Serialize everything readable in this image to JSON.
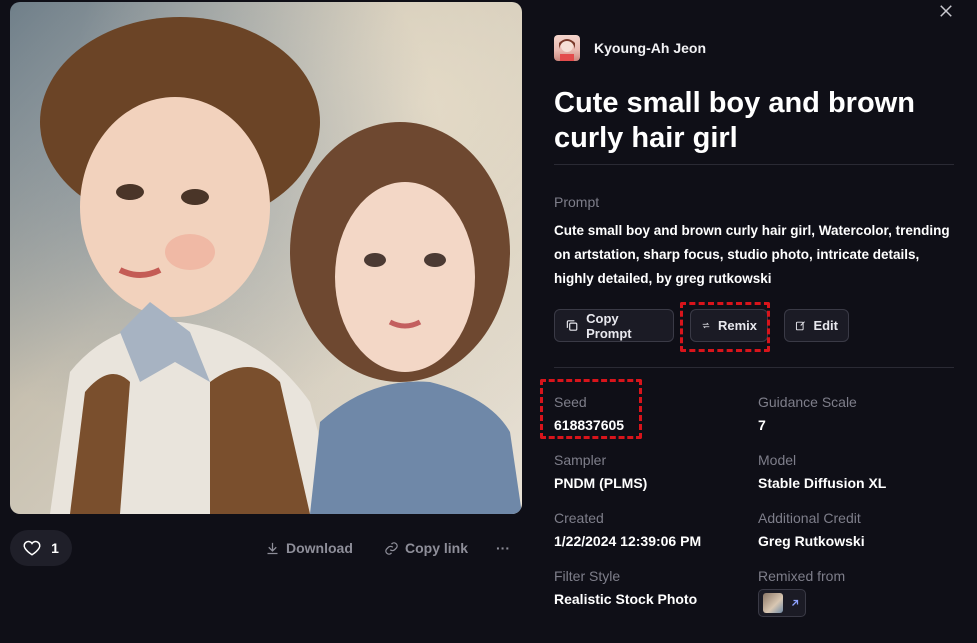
{
  "author": {
    "name": "Kyoung-Ah Jeon"
  },
  "title": "Cute small boy and brown curly hair girl",
  "prompt": {
    "label": "Prompt",
    "text": "Cute small boy and brown curly hair girl, Watercolor, trending on artstation, sharp focus, studio photo, intricate details, highly detailed, by greg rutkowski"
  },
  "buttons": {
    "copy_prompt": "Copy Prompt",
    "remix": "Remix",
    "edit": "Edit"
  },
  "meta": {
    "seed": {
      "label": "Seed",
      "value": "618837605"
    },
    "guidance": {
      "label": "Guidance Scale",
      "value": "7"
    },
    "sampler": {
      "label": "Sampler",
      "value": "PNDM (PLMS)"
    },
    "model": {
      "label": "Model",
      "value": "Stable Diffusion XL"
    },
    "created": {
      "label": "Created",
      "value": "1/22/2024 12:39:06 PM"
    },
    "credit": {
      "label": "Additional Credit",
      "value": "Greg Rutkowski"
    },
    "filter": {
      "label": "Filter Style",
      "value": "Realistic Stock Photo"
    },
    "remixed": {
      "label": "Remixed from"
    }
  },
  "image_actions": {
    "likes": "1",
    "download": "Download",
    "copy_link": "Copy link",
    "more": "···"
  },
  "icons": {
    "close": "close-icon",
    "heart": "heart-icon",
    "download": "download-icon",
    "link": "link-icon",
    "copy": "copy-icon",
    "remix": "remix-icon",
    "edit": "edit-icon",
    "arrow": "arrow-up-right-icon"
  },
  "colors": {
    "background": "#0f0f17",
    "highlight": "#d8141b",
    "button_bg": "#1b1b25"
  }
}
